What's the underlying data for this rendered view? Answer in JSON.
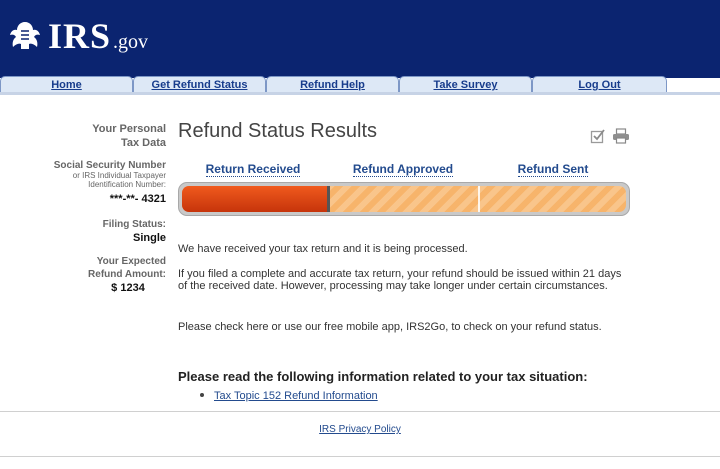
{
  "site": {
    "logo_text": "IRS",
    "logo_suffix": ".gov",
    "brand_color": "#0b2470"
  },
  "nav": {
    "tabs": [
      {
        "label": "Home"
      },
      {
        "label": "Get Refund Status"
      },
      {
        "label": "Refund Help"
      },
      {
        "label": "Take Survey"
      },
      {
        "label": "Log Out"
      }
    ]
  },
  "sidebar": {
    "title_line1": "Your Personal",
    "title_line2": "Tax Data",
    "ssn_label": "Social Security Number",
    "ssn_sub1": "or IRS Individual Taxpayer",
    "ssn_sub2": "Identification Number:",
    "ssn_value": "***-**- 4321",
    "filing_label": "Filing Status:",
    "filing_value": "Single",
    "refund_label1": "Your Expected",
    "refund_label2": "Refund Amount:",
    "refund_value": "$ 1234"
  },
  "main": {
    "title": "Refund Status Results",
    "icons": [
      "checkmark-icon",
      "print-icon"
    ],
    "steps": [
      {
        "label": "Return Received"
      },
      {
        "label": "Refund Approved"
      },
      {
        "label": "Refund Sent"
      }
    ],
    "progress": {
      "completed_steps": 1,
      "total_steps": 3,
      "fill_color": "#e4481a",
      "pending_color": "#f7b46b"
    },
    "msg1": "We have received your tax return and it is being processed.",
    "msg2": "If you filed a complete and accurate tax return, your refund should be issued within 21 days of the received date. However, processing may take longer under certain circumstances.",
    "msg3": "Please check here or use our free mobile app, IRS2Go, to check on your refund status.",
    "info_heading": "Please read the following information related to your tax situation:",
    "links": [
      {
        "label": "Tax Topic 152  Refund Information"
      }
    ]
  },
  "footer": {
    "privacy_link": "IRS Privacy Policy"
  }
}
